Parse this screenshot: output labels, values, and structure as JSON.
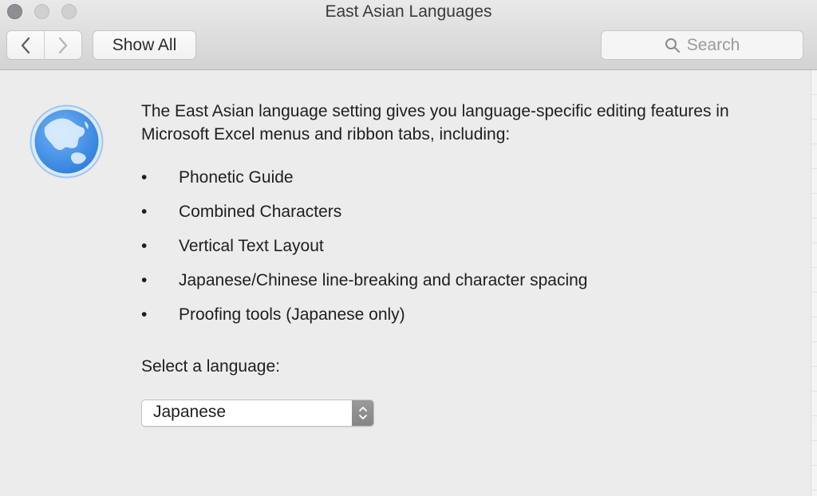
{
  "window": {
    "title": "East Asian Languages"
  },
  "toolbar": {
    "back_icon": "chevron-left-icon",
    "forward_icon": "chevron-right-icon",
    "show_all_label": "Show All",
    "search": {
      "placeholder": "Search",
      "icon": "search-icon"
    }
  },
  "content": {
    "icon": "globe-icon",
    "description": "The East Asian language setting gives you language-specific editing features in Microsoft Excel menus and ribbon tabs, including:",
    "features": [
      {
        "bullet": "•",
        "label": "Phonetic Guide"
      },
      {
        "bullet": "•",
        "label": "Combined Characters"
      },
      {
        "bullet": "•",
        "label": "Vertical Text Layout"
      },
      {
        "bullet": "•",
        "label": "Japanese/Chinese line-breaking and character spacing"
      },
      {
        "bullet": "•",
        "label": "Proofing tools (Japanese only)"
      }
    ],
    "select_label": "Select a language:",
    "language_select": {
      "selected": "Japanese"
    }
  },
  "colors": {
    "globe_blue": "#3d8fe6",
    "window_bg": "#ececec"
  }
}
